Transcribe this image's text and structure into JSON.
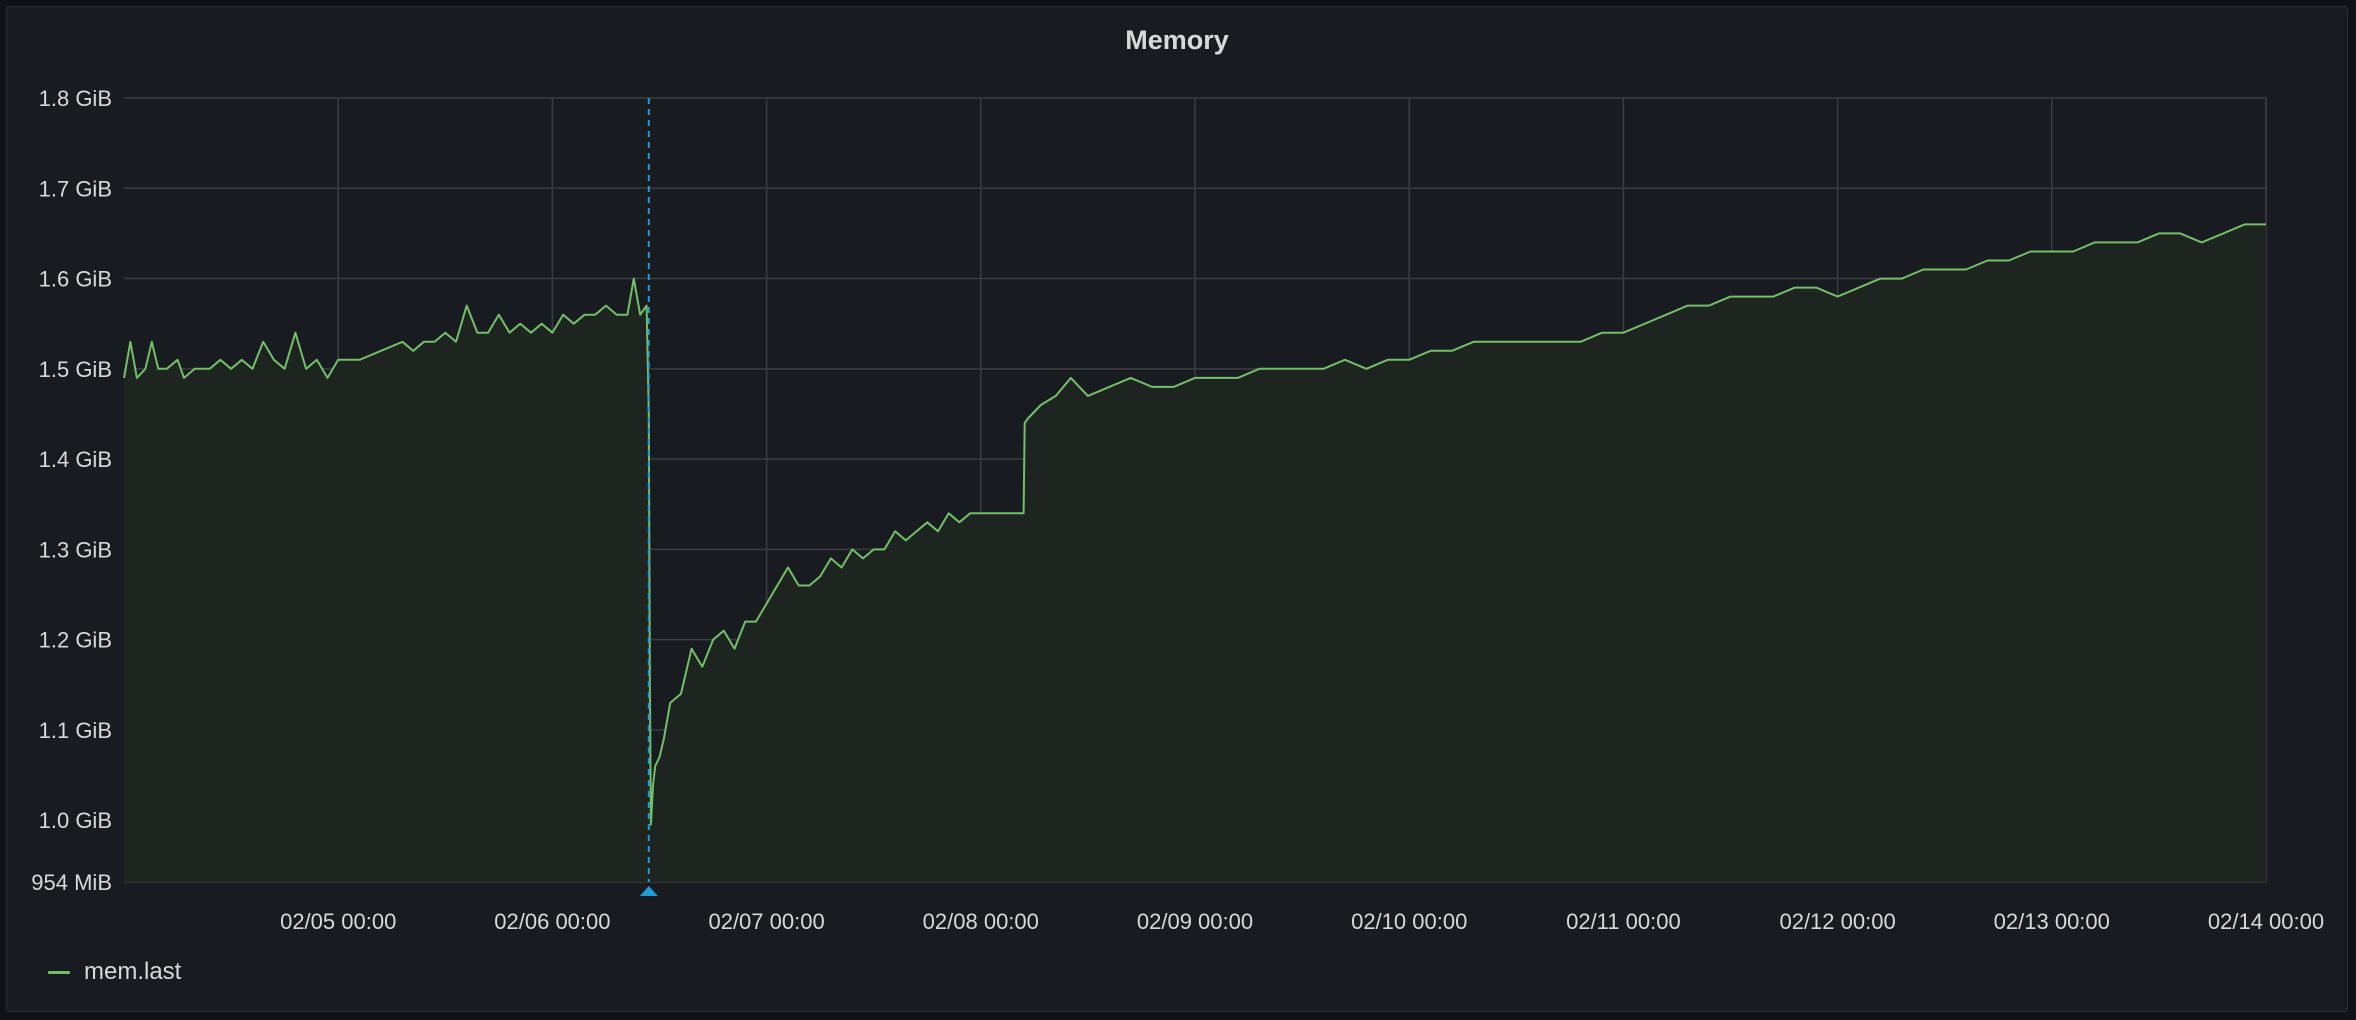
{
  "panel": {
    "title": "Memory"
  },
  "colors": {
    "series": "#73bf69",
    "fill": "#1e241f",
    "grid": "#3b3d42",
    "annotation": "#1f9bd6",
    "text": "#d8d9da"
  },
  "chart_data": {
    "type": "area",
    "ylabel": "",
    "xlabel": "",
    "grid": true,
    "legend_position": "bottom-left",
    "y_unit": "GiB",
    "ylim": [
      0.9316,
      1.8
    ],
    "y_ticks": [
      {
        "value": 0.9316,
        "label": "954 MiB"
      },
      {
        "value": 1.0,
        "label": "1.0 GiB"
      },
      {
        "value": 1.1,
        "label": "1.1 GiB"
      },
      {
        "value": 1.2,
        "label": "1.2 GiB"
      },
      {
        "value": 1.3,
        "label": "1.3 GiB"
      },
      {
        "value": 1.4,
        "label": "1.4 GiB"
      },
      {
        "value": 1.5,
        "label": "1.5 GiB"
      },
      {
        "value": 1.6,
        "label": "1.6 GiB"
      },
      {
        "value": 1.7,
        "label": "1.7 GiB"
      },
      {
        "value": 1.8,
        "label": "1.8 GiB"
      }
    ],
    "x_unit": "days",
    "xlim": [
      4.0,
      14.0
    ],
    "x_ticks": [
      {
        "value": 5,
        "label": "02/05 00:00"
      },
      {
        "value": 6,
        "label": "02/06 00:00"
      },
      {
        "value": 7,
        "label": "02/07 00:00"
      },
      {
        "value": 8,
        "label": "02/08 00:00"
      },
      {
        "value": 9,
        "label": "02/09 00:00"
      },
      {
        "value": 10,
        "label": "02/10 00:00"
      },
      {
        "value": 11,
        "label": "02/11 00:00"
      },
      {
        "value": 12,
        "label": "02/12 00:00"
      },
      {
        "value": 13,
        "label": "02/13 00:00"
      },
      {
        "value": 14,
        "label": "02/14 00:00"
      }
    ],
    "annotations": [
      {
        "x": 6.45,
        "label": ""
      }
    ],
    "series": [
      {
        "name": "mem.last",
        "points": [
          [
            4.0,
            1.49
          ],
          [
            4.03,
            1.53
          ],
          [
            4.06,
            1.49
          ],
          [
            4.1,
            1.5
          ],
          [
            4.13,
            1.53
          ],
          [
            4.16,
            1.5
          ],
          [
            4.2,
            1.5
          ],
          [
            4.25,
            1.51
          ],
          [
            4.28,
            1.49
          ],
          [
            4.33,
            1.5
          ],
          [
            4.4,
            1.5
          ],
          [
            4.45,
            1.51
          ],
          [
            4.5,
            1.5
          ],
          [
            4.55,
            1.51
          ],
          [
            4.6,
            1.5
          ],
          [
            4.65,
            1.53
          ],
          [
            4.7,
            1.51
          ],
          [
            4.75,
            1.5
          ],
          [
            4.8,
            1.54
          ],
          [
            4.85,
            1.5
          ],
          [
            4.9,
            1.51
          ],
          [
            4.95,
            1.49
          ],
          [
            5.0,
            1.51
          ],
          [
            5.1,
            1.51
          ],
          [
            5.2,
            1.52
          ],
          [
            5.3,
            1.53
          ],
          [
            5.35,
            1.52
          ],
          [
            5.4,
            1.53
          ],
          [
            5.45,
            1.53
          ],
          [
            5.5,
            1.54
          ],
          [
            5.55,
            1.53
          ],
          [
            5.6,
            1.57
          ],
          [
            5.65,
            1.54
          ],
          [
            5.7,
            1.54
          ],
          [
            5.75,
            1.56
          ],
          [
            5.8,
            1.54
          ],
          [
            5.85,
            1.55
          ],
          [
            5.9,
            1.54
          ],
          [
            5.95,
            1.55
          ],
          [
            6.0,
            1.54
          ],
          [
            6.05,
            1.56
          ],
          [
            6.1,
            1.55
          ],
          [
            6.15,
            1.56
          ],
          [
            6.2,
            1.56
          ],
          [
            6.25,
            1.57
          ],
          [
            6.3,
            1.56
          ],
          [
            6.35,
            1.56
          ],
          [
            6.38,
            1.6
          ],
          [
            6.41,
            1.56
          ],
          [
            6.44,
            1.57
          ],
          [
            6.45,
            1.45
          ],
          [
            6.455,
            1.15
          ],
          [
            6.46,
            0.995
          ],
          [
            6.47,
            1.04
          ],
          [
            6.48,
            1.06
          ],
          [
            6.5,
            1.07
          ],
          [
            6.52,
            1.09
          ],
          [
            6.55,
            1.13
          ],
          [
            6.6,
            1.14
          ],
          [
            6.65,
            1.19
          ],
          [
            6.7,
            1.17
          ],
          [
            6.75,
            1.2
          ],
          [
            6.8,
            1.21
          ],
          [
            6.85,
            1.19
          ],
          [
            6.9,
            1.22
          ],
          [
            6.95,
            1.22
          ],
          [
            7.0,
            1.24
          ],
          [
            7.05,
            1.26
          ],
          [
            7.1,
            1.28
          ],
          [
            7.15,
            1.26
          ],
          [
            7.2,
            1.26
          ],
          [
            7.25,
            1.27
          ],
          [
            7.3,
            1.29
          ],
          [
            7.35,
            1.28
          ],
          [
            7.4,
            1.3
          ],
          [
            7.45,
            1.29
          ],
          [
            7.5,
            1.3
          ],
          [
            7.55,
            1.3
          ],
          [
            7.6,
            1.32
          ],
          [
            7.65,
            1.31
          ],
          [
            7.7,
            1.32
          ],
          [
            7.75,
            1.33
          ],
          [
            7.8,
            1.32
          ],
          [
            7.85,
            1.34
          ],
          [
            7.9,
            1.33
          ],
          [
            7.95,
            1.34
          ],
          [
            8.0,
            1.34
          ],
          [
            8.1,
            1.34
          ],
          [
            8.2,
            1.34
          ],
          [
            8.205,
            1.44
          ],
          [
            8.22,
            1.445
          ],
          [
            8.28,
            1.46
          ],
          [
            8.35,
            1.47
          ],
          [
            8.42,
            1.49
          ],
          [
            8.5,
            1.47
          ],
          [
            8.6,
            1.48
          ],
          [
            8.7,
            1.49
          ],
          [
            8.8,
            1.48
          ],
          [
            8.9,
            1.48
          ],
          [
            9.0,
            1.49
          ],
          [
            9.1,
            1.49
          ],
          [
            9.2,
            1.49
          ],
          [
            9.3,
            1.5
          ],
          [
            9.4,
            1.5
          ],
          [
            9.5,
            1.5
          ],
          [
            9.6,
            1.5
          ],
          [
            9.7,
            1.51
          ],
          [
            9.8,
            1.5
          ],
          [
            9.9,
            1.51
          ],
          [
            10.0,
            1.51
          ],
          [
            10.1,
            1.52
          ],
          [
            10.2,
            1.52
          ],
          [
            10.3,
            1.53
          ],
          [
            10.4,
            1.53
          ],
          [
            10.5,
            1.53
          ],
          [
            10.6,
            1.53
          ],
          [
            10.7,
            1.53
          ],
          [
            10.8,
            1.53
          ],
          [
            10.9,
            1.54
          ],
          [
            11.0,
            1.54
          ],
          [
            11.1,
            1.55
          ],
          [
            11.2,
            1.56
          ],
          [
            11.3,
            1.57
          ],
          [
            11.4,
            1.57
          ],
          [
            11.5,
            1.58
          ],
          [
            11.6,
            1.58
          ],
          [
            11.7,
            1.58
          ],
          [
            11.8,
            1.59
          ],
          [
            11.9,
            1.59
          ],
          [
            12.0,
            1.58
          ],
          [
            12.1,
            1.59
          ],
          [
            12.2,
            1.6
          ],
          [
            12.3,
            1.6
          ],
          [
            12.4,
            1.61
          ],
          [
            12.5,
            1.61
          ],
          [
            12.6,
            1.61
          ],
          [
            12.7,
            1.62
          ],
          [
            12.8,
            1.62
          ],
          [
            12.9,
            1.63
          ],
          [
            13.0,
            1.63
          ],
          [
            13.1,
            1.63
          ],
          [
            13.2,
            1.64
          ],
          [
            13.3,
            1.64
          ],
          [
            13.4,
            1.64
          ],
          [
            13.5,
            1.65
          ],
          [
            13.6,
            1.65
          ],
          [
            13.7,
            1.64
          ],
          [
            13.8,
            1.65
          ],
          [
            13.9,
            1.66
          ],
          [
            14.0,
            1.66
          ]
        ]
      }
    ]
  },
  "legend": {
    "items": [
      {
        "name": "mem.last"
      }
    ]
  }
}
